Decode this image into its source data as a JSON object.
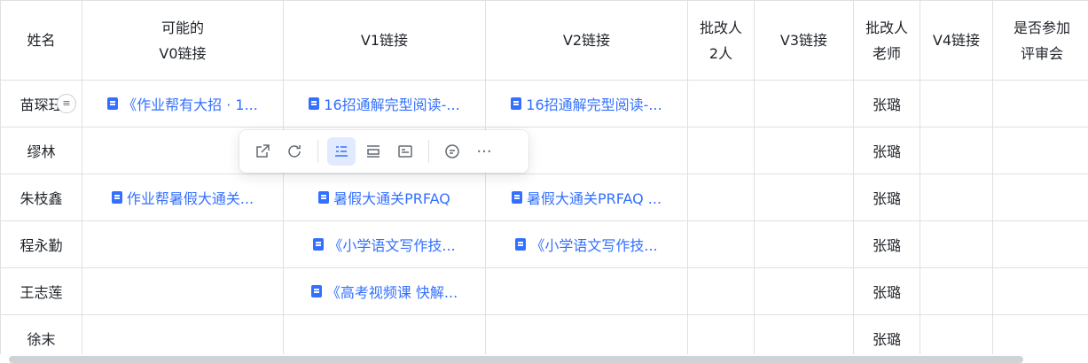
{
  "headers": [
    [
      "姓名"
    ],
    [
      "可能的",
      "V0链接"
    ],
    [
      "V1链接"
    ],
    [
      "V2链接"
    ],
    [
      "批改人",
      "2人"
    ],
    [
      "V3链接"
    ],
    [
      "批改人",
      "老师"
    ],
    [
      "V4链接"
    ],
    [
      "是否参加",
      "评审会"
    ]
  ],
  "rows": [
    {
      "name": "苗琛珏",
      "v0": "《作业帮有大招 · 1...",
      "v1": "16招通解完型阅读-...",
      "v2": "16招通解完型阅读-...",
      "grader2": "",
      "v3": "",
      "teacher": "张璐",
      "v4": "",
      "review": ""
    },
    {
      "name": "缪林",
      "v0": "",
      "v1": "",
      "v2": "",
      "grader2": "",
      "v3": "",
      "teacher": "张璐",
      "v4": "",
      "review": ""
    },
    {
      "name": "朱枝鑫",
      "v0": "作业帮暑假大通关...",
      "v1": "暑假大通关PRFAQ",
      "v2": "暑假大通关PRFAQ ...",
      "grader2": "",
      "v3": "",
      "teacher": "张璐",
      "v4": "",
      "review": ""
    },
    {
      "name": "程永勤",
      "v0": "",
      "v1": "《小学语文写作技...",
      "v2": "《小学语文写作技...",
      "grader2": "",
      "v3": "",
      "teacher": "张璐",
      "v4": "",
      "review": ""
    },
    {
      "name": "王志莲",
      "v0": "",
      "v1": "《高考视频课 快解...",
      "v2": "",
      "grader2": "",
      "v3": "",
      "teacher": "张璐",
      "v4": "",
      "review": ""
    },
    {
      "name": "徐末",
      "v0": "",
      "v1": "",
      "v2": "",
      "grader2": "",
      "v3": "",
      "teacher": "张璐",
      "v4": "",
      "review": ""
    }
  ],
  "row_handle_icon": "list-icon",
  "toolbar": {
    "buttons": [
      {
        "name": "open-in-new-icon",
        "active": false
      },
      {
        "name": "refresh-icon",
        "active": false
      },
      {
        "name": "view-list-icon",
        "active": true
      },
      {
        "name": "view-title-icon",
        "active": false
      },
      {
        "name": "view-card-icon",
        "active": false
      },
      {
        "name": "comment-icon",
        "active": false
      },
      {
        "name": "more-icon",
        "active": false
      }
    ],
    "more_glyph": "···"
  },
  "colors": {
    "link": "#3370ff",
    "border": "#dee0e3",
    "active_bg": "#e1eaff"
  }
}
